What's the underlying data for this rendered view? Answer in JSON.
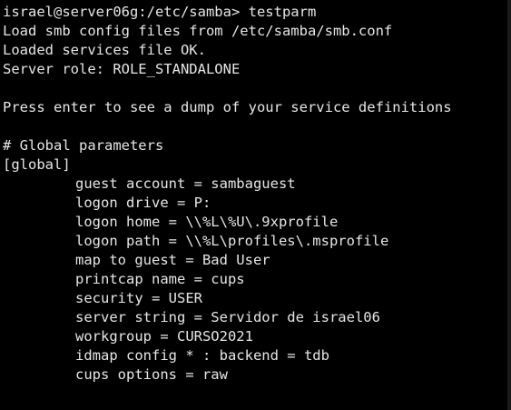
{
  "terminal": {
    "prompt": "israel@server06g:/etc/samba> testparm",
    "output": [
      "Load smb config files from /etc/samba/smb.conf",
      "Loaded services file OK.",
      "Server role: ROLE_STANDALONE",
      "",
      "Press enter to see a dump of your service definitions",
      "",
      "# Global parameters",
      "[global]"
    ],
    "global_params": [
      "guest account = sambaguest",
      "logon drive = P:",
      "logon home = \\\\%L\\%U\\.9xprofile",
      "logon path = \\\\%L\\profiles\\.msprofile",
      "map to guest = Bad User",
      "printcap name = cups",
      "security = USER",
      "server string = Servidor de israel06",
      "workgroup = CURSO2021",
      "idmap config * : backend = tdb",
      "cups options = raw"
    ]
  },
  "colors": {
    "background": "#000000",
    "foreground": "#e6e6e6"
  }
}
